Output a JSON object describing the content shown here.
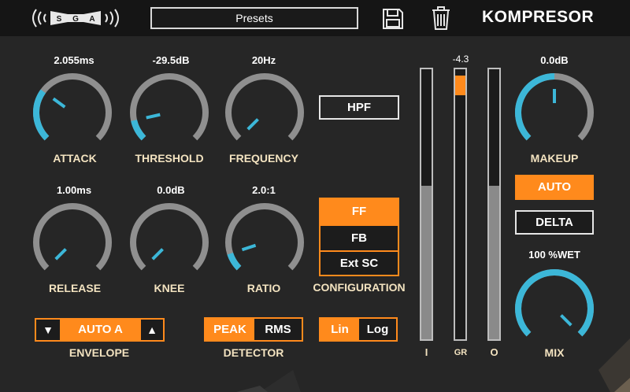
{
  "header": {
    "logo_text": "SGA",
    "presets_label": "Presets",
    "title": "KOMPRESOR"
  },
  "knobs": {
    "attack": {
      "value": "2.055ms",
      "label": "ATTACK",
      "level": 0.3
    },
    "threshold": {
      "value": "-29.5dB",
      "label": "THRESHOLD",
      "level": 0.12
    },
    "frequency": {
      "value": "20Hz",
      "label": "FREQUENCY",
      "level": 0.0
    },
    "release": {
      "value": "1.00ms",
      "label": "RELEASE",
      "level": 0.0
    },
    "knee": {
      "value": "0.0dB",
      "label": "KNEE",
      "level": 0.0
    },
    "ratio": {
      "value": "2.0:1",
      "label": "RATIO",
      "level": 0.1
    },
    "makeup": {
      "value": "0.0dB",
      "label": "MAKEUP",
      "level": 0.5
    },
    "mix": {
      "value": "100 %WET",
      "label": "MIX",
      "level": 1.0
    }
  },
  "filter": {
    "hpf_label": "HPF"
  },
  "configuration": {
    "label": "CONFIGURATION",
    "options": [
      "FF",
      "FB",
      "Ext SC"
    ],
    "selected": "FF"
  },
  "envelope": {
    "label": "ENVELOPE",
    "value": "AUTO A"
  },
  "detector": {
    "label": "DETECTOR",
    "options": [
      "PEAK",
      "RMS"
    ],
    "selected": "PEAK"
  },
  "scale": {
    "options": [
      "Lin",
      "Log"
    ],
    "selected": "Lin"
  },
  "meters": {
    "gr_value": "-4.3",
    "input": {
      "label": "I",
      "level": 0.57
    },
    "gr": {
      "label": "GR",
      "level": 0.08
    },
    "output": {
      "label": "O",
      "level": 0.57
    }
  },
  "buttons": {
    "auto": "AUTO",
    "delta": "DELTA"
  },
  "colors": {
    "accent_blue": "#3cb7d8",
    "accent_orange": "#ff8a1c",
    "cream_label": "#f3e3c0",
    "background": "#262626"
  }
}
